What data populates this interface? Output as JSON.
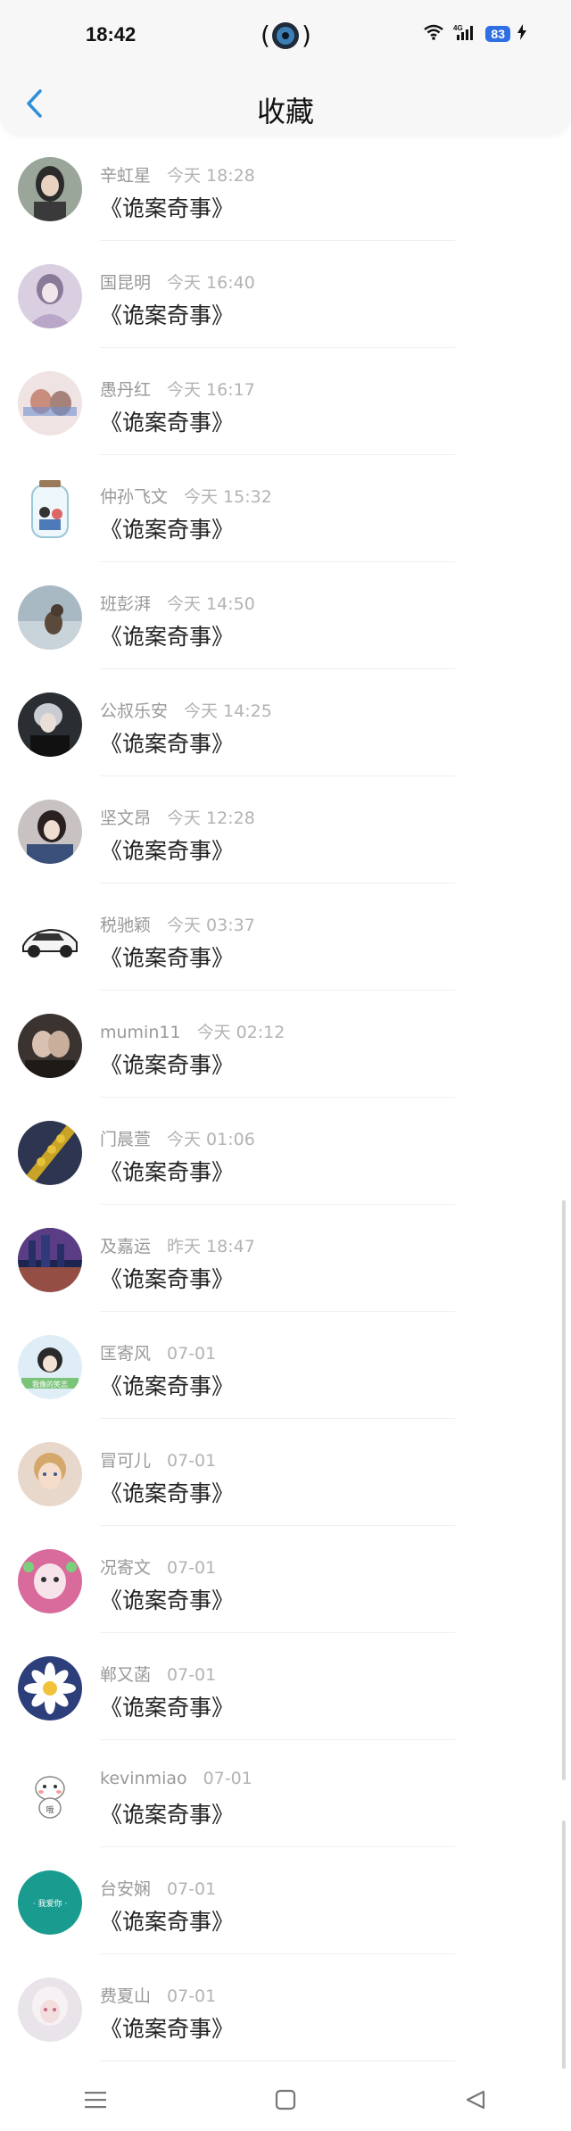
{
  "status_bar": {
    "time": "18:42",
    "network": "4G",
    "battery": "83"
  },
  "header": {
    "title": "收藏"
  },
  "items": [
    {
      "name": "辛虹星",
      "time": "今天 18:28",
      "title": "《诡案奇事》"
    },
    {
      "name": "国昆明",
      "time": "今天 16:40",
      "title": "《诡案奇事》"
    },
    {
      "name": "愚丹红",
      "time": "今天 16:17",
      "title": "《诡案奇事》"
    },
    {
      "name": "仲孙飞文",
      "time": "今天 15:32",
      "title": "《诡案奇事》"
    },
    {
      "name": "班彭湃",
      "time": "今天 14:50",
      "title": "《诡案奇事》"
    },
    {
      "name": "公叔乐安",
      "time": "今天 14:25",
      "title": "《诡案奇事》"
    },
    {
      "name": "坚文昂",
      "time": "今天 12:28",
      "title": "《诡案奇事》"
    },
    {
      "name": "税驰颖",
      "time": "今天 03:37",
      "title": "《诡案奇事》"
    },
    {
      "name": "mumin11",
      "time": "今天 02:12",
      "title": "《诡案奇事》"
    },
    {
      "name": "门晨萱",
      "time": "今天 01:06",
      "title": "《诡案奇事》"
    },
    {
      "name": "及嘉运",
      "time": "昨天 18:47",
      "title": "《诡案奇事》"
    },
    {
      "name": "匡寄风",
      "time": "07-01",
      "title": "《诡案奇事》"
    },
    {
      "name": "冒可儿",
      "time": "07-01",
      "title": "《诡案奇事》"
    },
    {
      "name": "况寄文",
      "time": "07-01",
      "title": "《诡案奇事》"
    },
    {
      "name": "郸又菡",
      "time": "07-01",
      "title": "《诡案奇事》"
    },
    {
      "name": "kevinmiao",
      "time": "07-01",
      "title": "《诡案奇事》"
    },
    {
      "name": "台安娴",
      "time": "07-01",
      "title": "《诡案奇事》"
    },
    {
      "name": "费夏山",
      "time": "07-01",
      "title": "《诡案奇事》"
    }
  ],
  "avatar_text": {
    "item_12": "我像的笑志",
    "item_17": "· 我爱你 ·",
    "item_16": "哦"
  },
  "colors": {
    "accent": "#2f8fd8",
    "name_gray": "#999999",
    "time_gray": "#b3b3b3"
  }
}
